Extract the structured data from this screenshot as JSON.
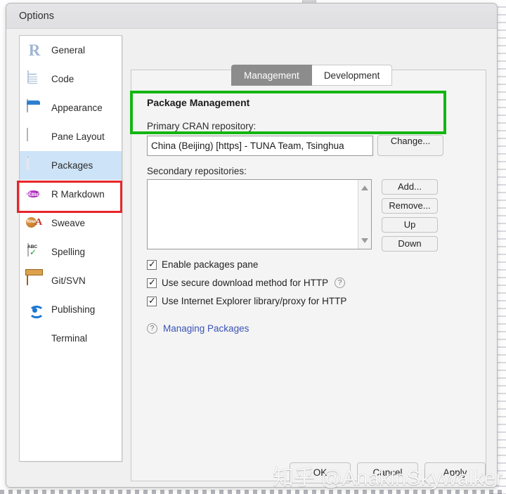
{
  "window": {
    "title": "Options"
  },
  "sidebar": {
    "items": [
      {
        "label": "General",
        "icon": "r-logo-icon",
        "selected": false
      },
      {
        "label": "Code",
        "icon": "code-document-icon",
        "selected": false
      },
      {
        "label": "Appearance",
        "icon": "paint-bucket-icon",
        "selected": false
      },
      {
        "label": "Pane Layout",
        "icon": "pane-grid-icon",
        "selected": false
      },
      {
        "label": "Packages",
        "icon": "package-box-icon",
        "selected": true
      },
      {
        "label": "R Markdown",
        "icon": "rmd-badge-icon",
        "selected": false
      },
      {
        "label": "Sweave",
        "icon": "sweave-pdf-icon",
        "selected": false
      },
      {
        "label": "Spelling",
        "icon": "spellcheck-icon",
        "selected": false
      },
      {
        "label": "Git/SVN",
        "icon": "open-box-icon",
        "selected": false
      },
      {
        "label": "Publishing",
        "icon": "publish-icon",
        "selected": false
      },
      {
        "label": "Terminal",
        "icon": "terminal-icon",
        "selected": false
      }
    ]
  },
  "tabs": [
    {
      "label": "Management",
      "active": true
    },
    {
      "label": "Development",
      "active": false
    }
  ],
  "main": {
    "heading": "Package Management",
    "primary_cran": {
      "label": "Primary CRAN repository:",
      "value": "China (Beijing) [https] - TUNA Team, Tsinghua",
      "change_button": "Change..."
    },
    "secondary": {
      "label": "Secondary repositories:",
      "items": [],
      "buttons": [
        {
          "label": "Add..."
        },
        {
          "label": "Remove..."
        },
        {
          "label": "Up"
        },
        {
          "label": "Down"
        }
      ],
      "scroll_up_icon": "scroll-up-arrow-icon",
      "scroll_down_icon": "scroll-down-arrow-icon"
    },
    "checkboxes": [
      {
        "label": "Enable packages pane",
        "checked": true,
        "help": false
      },
      {
        "label": "Use secure download method for HTTP",
        "checked": true,
        "help": true,
        "help_icon": "question-mark-icon"
      },
      {
        "label": "Use Internet Explorer library/proxy for HTTP",
        "checked": true,
        "help": false
      }
    ],
    "help_link": {
      "icon": "question-mark-icon",
      "label": "Managing Packages"
    }
  },
  "footer": {
    "buttons": [
      {
        "label": "OK"
      },
      {
        "label": "Cancel"
      },
      {
        "label": "Apply"
      }
    ]
  },
  "annotations": {
    "packages_highlight_color": "#e8252a",
    "cran_highlight_color": "#14b512"
  },
  "watermark": {
    "text": "知乎 @AnakinSkywalker"
  }
}
